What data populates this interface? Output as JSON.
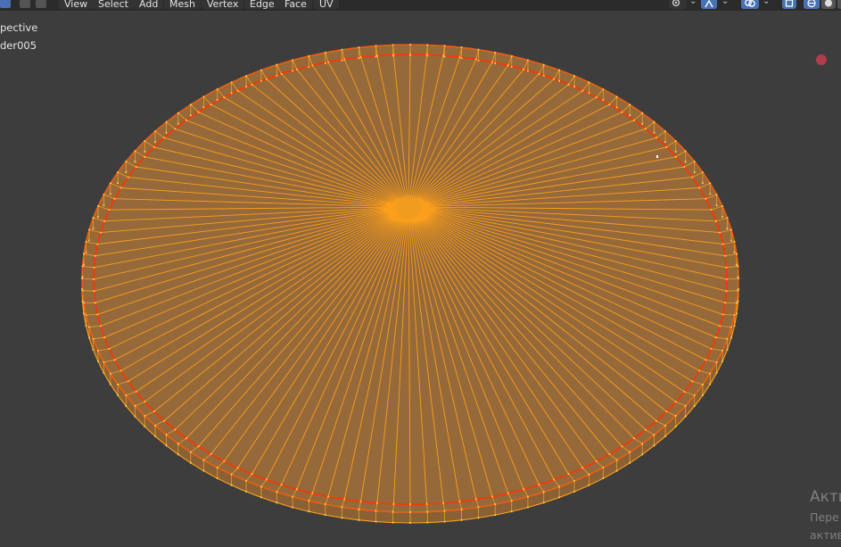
{
  "header": {
    "menus": [
      "View",
      "Select",
      "Add",
      "Mesh",
      "Vertex",
      "Edge",
      "Face",
      "UV"
    ]
  },
  "overlay": {
    "view_name": "pective",
    "object_name": "der005"
  },
  "watermark": {
    "line1": "Акти",
    "line2": "Пере",
    "line3": "актив"
  },
  "colors": {
    "background": "#3d3d3d",
    "face_fill": "#96693a",
    "wire": "#ffa11a",
    "edge_selected": "#ff3300",
    "accent": "#4772b3"
  },
  "icons": [
    "vertex-select-icon",
    "edge-select-icon",
    "face-select-icon",
    "pivot-icon",
    "snap-icon",
    "overlay-icon",
    "xray-icon",
    "wireframe-shading-icon",
    "solid-shading-icon"
  ]
}
